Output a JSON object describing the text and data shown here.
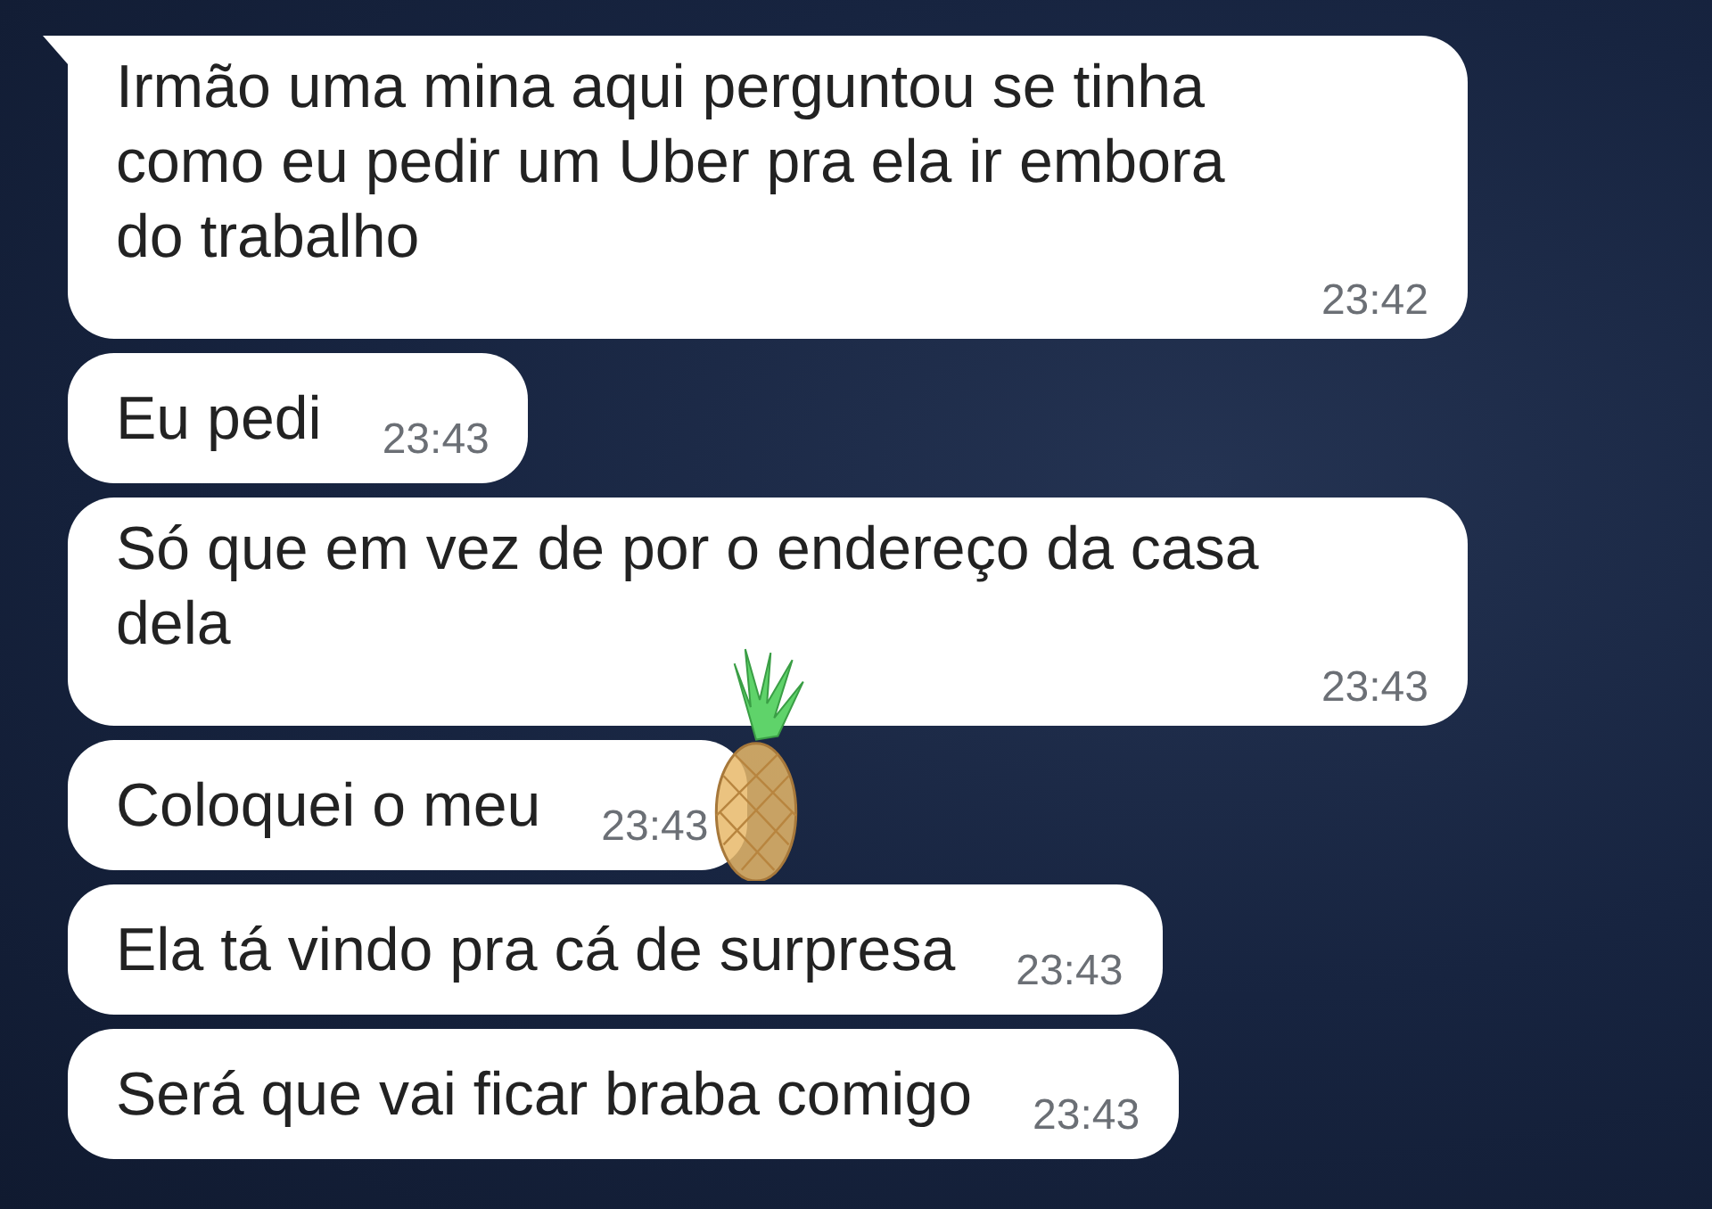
{
  "messages": [
    {
      "text": "Irmão uma mina aqui perguntou se tinha como eu pedir um Uber pra ela ir embora do trabalho",
      "time": "23:42",
      "kind": "wrapped",
      "tail": true,
      "sticker": false
    },
    {
      "text": "Eu pedi",
      "time": "23:43",
      "kind": "inline",
      "tail": false,
      "sticker": false
    },
    {
      "text": "Só que em vez de por o endereço da casa dela",
      "time": "23:43",
      "kind": "wrapped",
      "tail": false,
      "sticker": false
    },
    {
      "text": "Coloquei o meu",
      "time": "23:43",
      "kind": "inline",
      "tail": false,
      "sticker": true
    },
    {
      "text": "Ela tá vindo pra cá de surpresa",
      "time": "23:43",
      "kind": "inline",
      "tail": false,
      "sticker": false
    },
    {
      "text": "Será que vai ficar braba comigo",
      "time": "23:43",
      "kind": "inline",
      "tail": false,
      "sticker": false
    }
  ]
}
